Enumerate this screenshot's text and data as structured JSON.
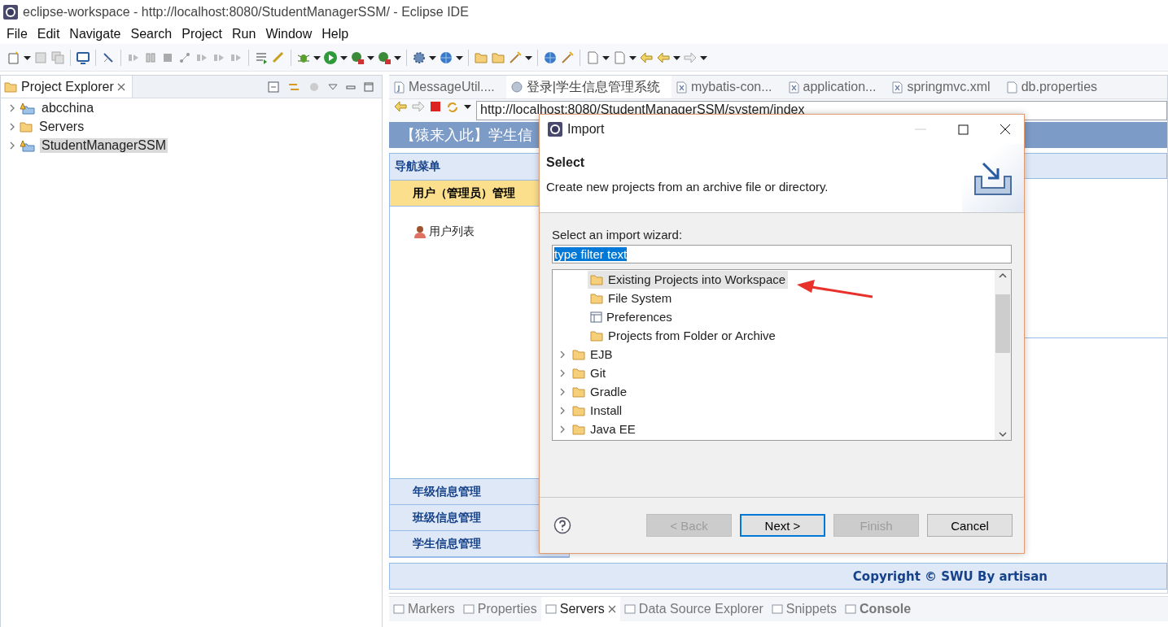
{
  "window": {
    "title": "eclipse-workspace - http://localhost:8080/StudentManagerSSM/ - Eclipse IDE"
  },
  "menu": [
    "File",
    "Edit",
    "Navigate",
    "Search",
    "Project",
    "Run",
    "Window",
    "Help"
  ],
  "project_explorer": {
    "title": "Project Explorer",
    "items": [
      {
        "label": "abcchina",
        "kind": "project",
        "expanded": false,
        "selected": false
      },
      {
        "label": "Servers",
        "kind": "folder",
        "expanded": false,
        "selected": false
      },
      {
        "label": "StudentManagerSSM",
        "kind": "project",
        "expanded": false,
        "selected": true
      }
    ]
  },
  "editor_tabs": [
    {
      "label": "MessageUtil....",
      "kind": "java",
      "selected": false
    },
    {
      "label": "登录|学生信息管理系统",
      "kind": "web",
      "selected": true
    },
    {
      "label": "mybatis-con...",
      "kind": "xml",
      "selected": false
    },
    {
      "label": "application...",
      "kind": "xml",
      "selected": false
    },
    {
      "label": "springmvc.xml",
      "kind": "xml",
      "selected": false
    },
    {
      "label": "db.properties",
      "kind": "file",
      "selected": false
    }
  ],
  "browser": {
    "url": "http://localhost:8080/StudentManagerSSM/system/index"
  },
  "web_page": {
    "header": "【猿来入此】学生信",
    "nav": {
      "title": "导航菜单",
      "sections": [
        {
          "label": "用户（管理员）管理",
          "expanded": true,
          "children": [
            {
              "label": "用户列表"
            }
          ]
        },
        {
          "label": "年级信息管理",
          "expanded": false
        },
        {
          "label": "班级信息管理",
          "expanded": false
        },
        {
          "label": "学生信息管理",
          "expanded": false
        }
      ]
    },
    "footer": "Copyright © SWU By artisan"
  },
  "bottom_tabs": [
    {
      "label": "Markers",
      "selected": false,
      "unread": false
    },
    {
      "label": "Properties",
      "selected": false,
      "unread": false
    },
    {
      "label": "Servers",
      "selected": true,
      "unread": false
    },
    {
      "label": "Data Source Explorer",
      "selected": false,
      "unread": false
    },
    {
      "label": "Snippets",
      "selected": false,
      "unread": false
    },
    {
      "label": "Console",
      "selected": false,
      "unread": true
    }
  ],
  "dialog": {
    "title": "Import",
    "heading": "Select",
    "description": "Create new projects from an archive file or directory.",
    "filter_label": "Select an import wizard:",
    "filter": {
      "value": "type filter text",
      "text_selected": true
    },
    "wizards": [
      {
        "label": "Existing Projects into Workspace",
        "kind": "wizard",
        "selected": true
      },
      {
        "label": "File System",
        "kind": "wizard",
        "selected": false
      },
      {
        "label": "Preferences",
        "kind": "setting",
        "selected": false
      },
      {
        "label": "Projects from Folder or Archive",
        "kind": "wizard",
        "selected": false
      },
      {
        "label": "EJB",
        "kind": "category",
        "selected": false
      },
      {
        "label": "Git",
        "kind": "category",
        "selected": false
      },
      {
        "label": "Gradle",
        "kind": "category",
        "selected": false
      },
      {
        "label": "Install",
        "kind": "category",
        "selected": false
      },
      {
        "label": "Java EE",
        "kind": "category",
        "selected": false
      }
    ],
    "buttons": [
      {
        "label": "< Back",
        "disabled": true,
        "default": false
      },
      {
        "label": "Next >",
        "disabled": false,
        "default": true
      },
      {
        "label": "Finish",
        "disabled": true,
        "default": false
      },
      {
        "label": "Cancel",
        "disabled": false,
        "default": false
      }
    ]
  }
}
